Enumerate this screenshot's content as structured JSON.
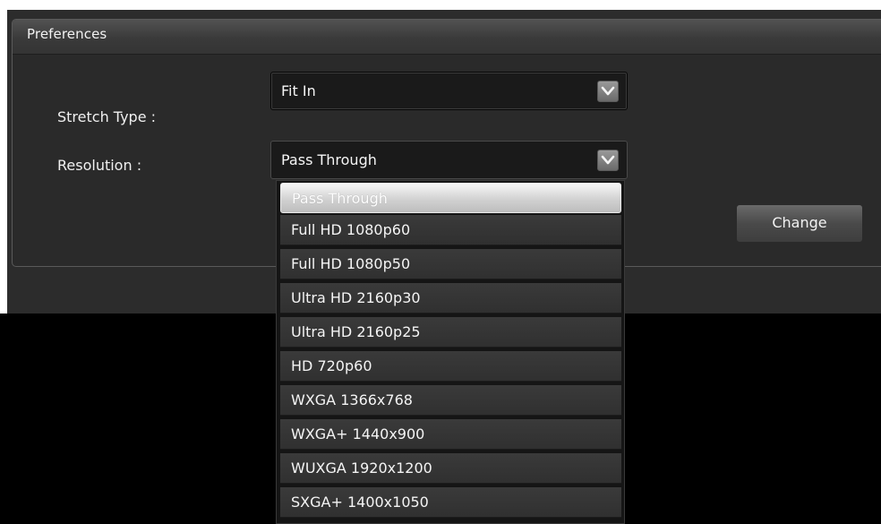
{
  "panel": {
    "title": "Preferences"
  },
  "stretch_type": {
    "label": "Stretch Type :",
    "value": "Fit In"
  },
  "resolution": {
    "label": "Resolution :",
    "value": "Pass Through",
    "options": [
      "Pass Through",
      "Full HD 1080p60",
      "Full HD 1080p50",
      "Ultra HD 2160p30",
      "Ultra HD 2160p25",
      "HD 720p60",
      "WXGA 1366x768",
      "WXGA+ 1440x900",
      "WUXGA 1920x1200",
      "SXGA+ 1400x1050"
    ],
    "selected_index": 0
  },
  "change_button": {
    "label": "Change"
  },
  "icons": {
    "dropdown_arrow": "chevron-down-icon"
  },
  "colors": {
    "panel_bg": "#2a2a2a",
    "header_bg": "#3a3a3a",
    "select_bg": "#1a1a1a",
    "option_bg": "#333333",
    "selected_option_bg": "#d8d8d8",
    "text": "#f2f2f2"
  }
}
